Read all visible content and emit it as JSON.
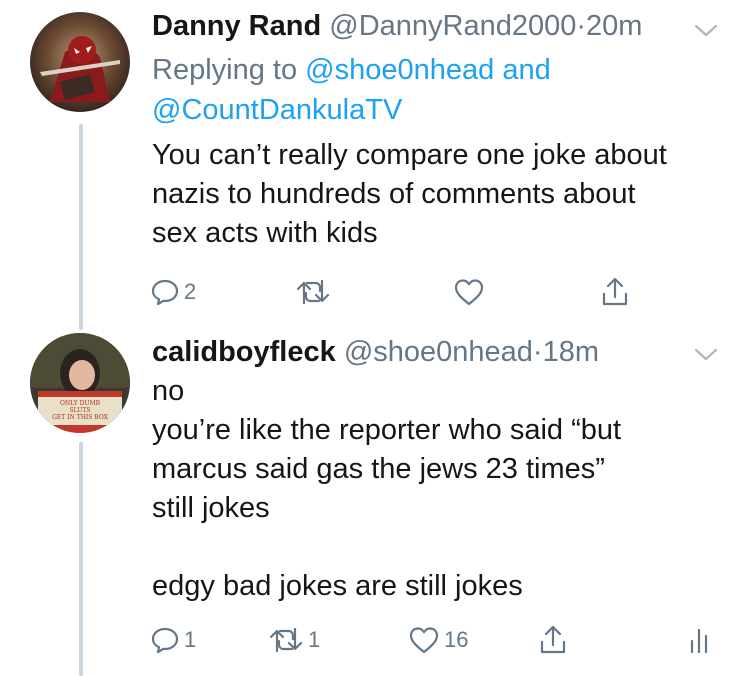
{
  "tweets": [
    {
      "display_name": "Danny Rand",
      "handle": "@DannyRand2000",
      "separator": "·",
      "time": "20m",
      "replying_prefix": "Replying to",
      "replying_user1": "@shoe0nhead",
      "replying_and": "and",
      "replying_user2": "@CountDankulaTV",
      "text": "You can’t really compare one joke about\nnazis to hundreds of comments about\nsex acts with kids",
      "reply_count": "2",
      "retweet_count": "",
      "like_count": ""
    },
    {
      "display_name": "calidboyfleck",
      "handle": "@shoe0nhead",
      "separator": "·",
      "time": "18m",
      "text": "no\nyou’re like the reporter who said “but\nmarcus said gas the jews 23 times”\nstill jokes\n\nedgy bad jokes are still jokes",
      "avatar_sign_text": "ONLY DUMB SLUTS GET IN THIS BOX",
      "reply_count": "1",
      "retweet_count": "1",
      "like_count": "16"
    }
  ],
  "colors": {
    "name": "#14171a",
    "secondary": "#657786",
    "link": "#1da1f2",
    "thread_line": "#ccd6dd"
  },
  "icons": [
    "reply-icon",
    "retweet-icon",
    "like-icon",
    "share-icon",
    "analytics-icon",
    "chevron-down-icon"
  ]
}
